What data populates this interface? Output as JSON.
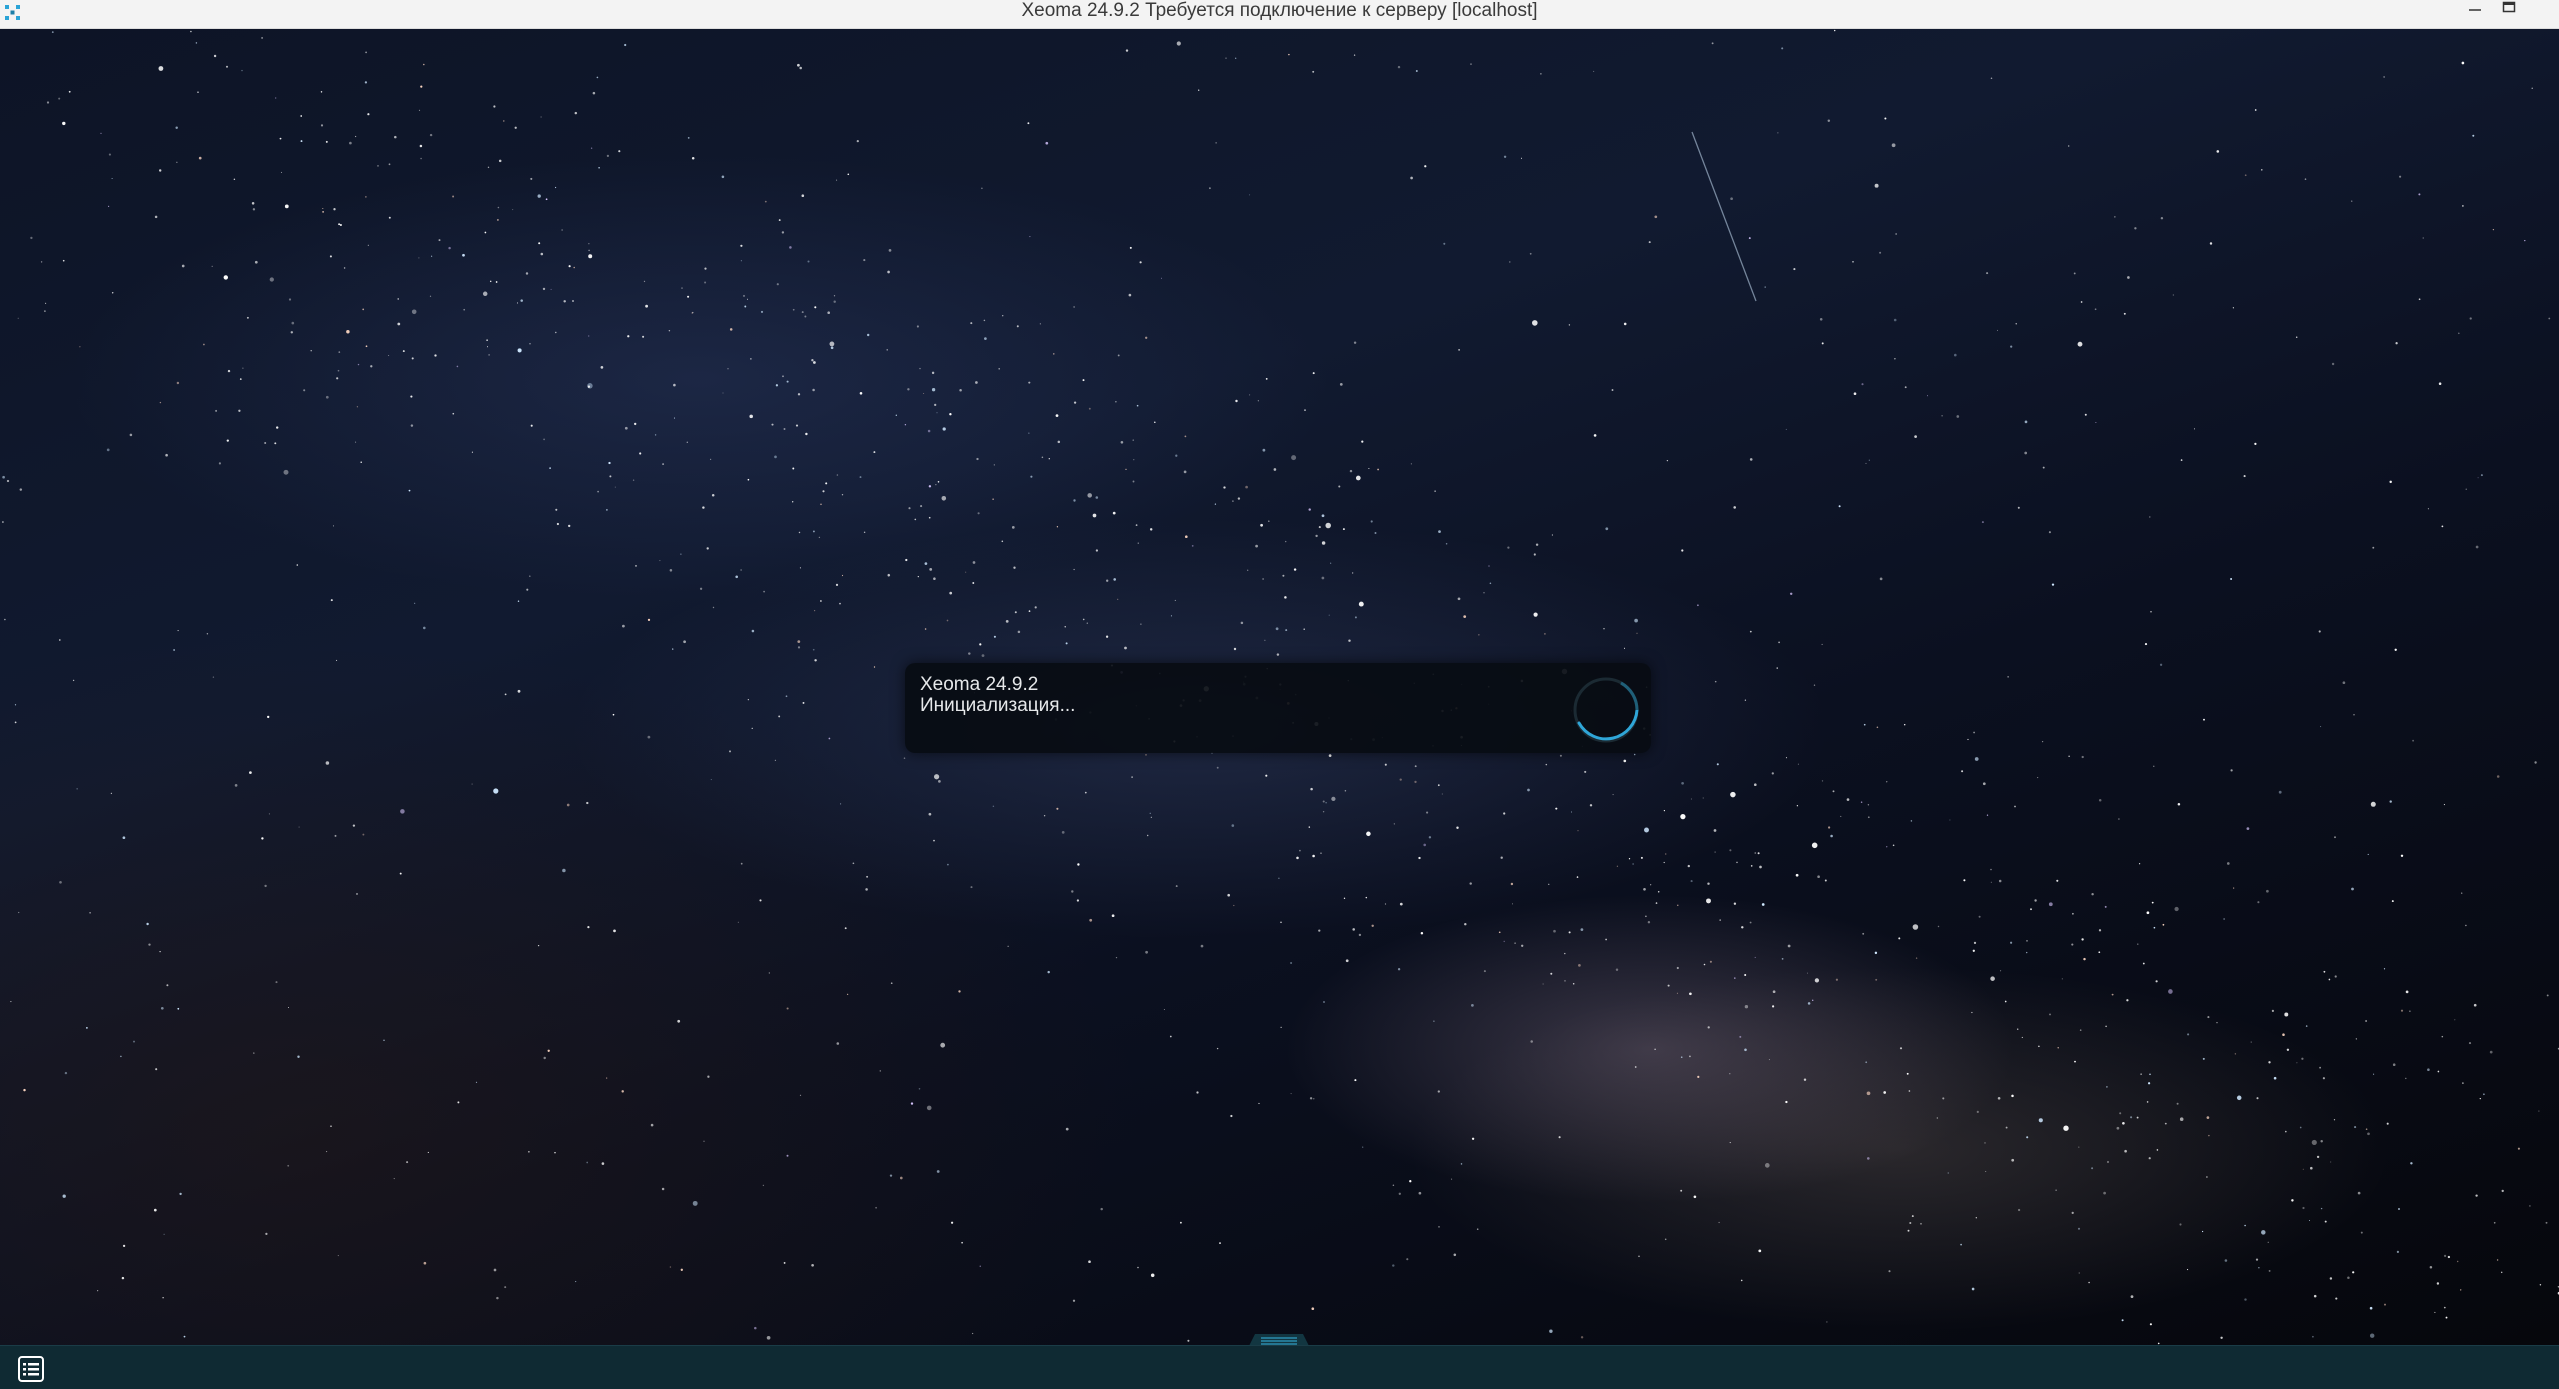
{
  "window": {
    "title": "Xeoma 24.9.2 Требуется подключение к серверу [localhost]"
  },
  "loader": {
    "app_name": "Xeoma 24.9.2",
    "status": "Инициализация..."
  },
  "icons": {
    "app_logo": "xeoma-logo-icon",
    "minimize": "minimize-icon",
    "maximize": "maximize-icon",
    "menu": "list-menu-icon",
    "spinner": "loading-spinner-icon",
    "panel_handle": "panel-handle-icon"
  },
  "colors": {
    "accent": "#2fa6d8",
    "bottom_bar": "#0f2a33",
    "loader_bg": "#080c12"
  }
}
